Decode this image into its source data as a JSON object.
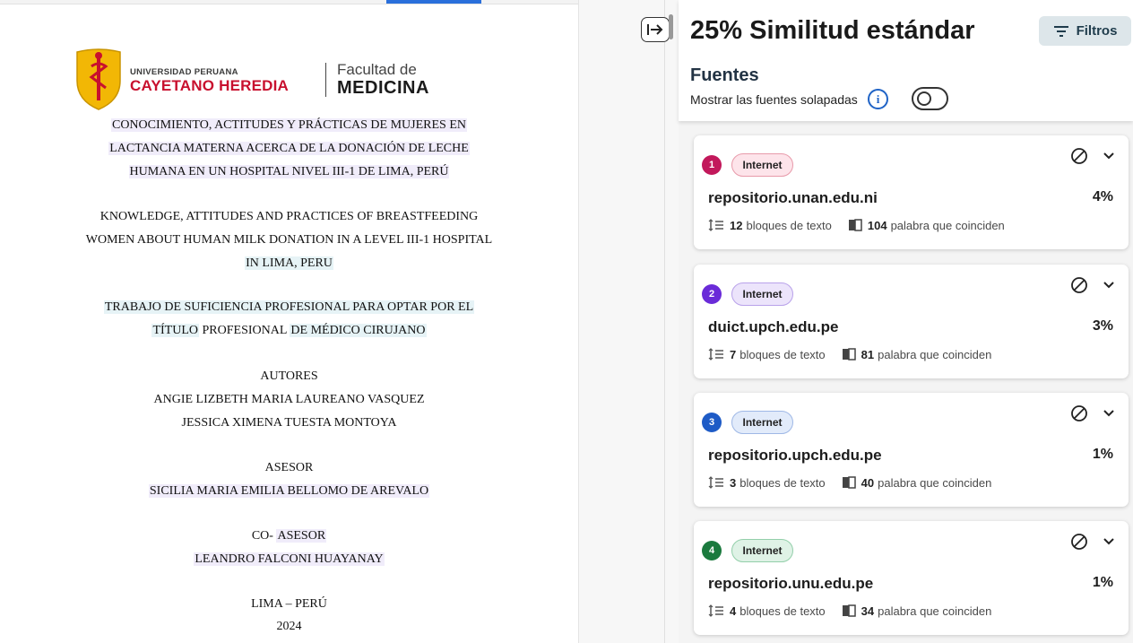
{
  "document": {
    "logo": {
      "university_line1": "UNIVERSIDAD PERUANA",
      "university_line2": "CAYETANO HEREDIA",
      "faculty_line1": "Facultad de",
      "faculty_line2": "MEDICINA",
      "shield_colors": [
        "#f2b705",
        "#c8102e"
      ]
    },
    "title_es": [
      "CONOCIMIENTO, ACTITUDES Y PRÁCTICAS DE MUJERES EN",
      "LACTANCIA MATERNA ACERCA DE LA DONACIÓN DE LECHE",
      "HUMANA EN UN HOSPITAL NIVEL III-1 DE LIMA, PERÚ"
    ],
    "title_en": [
      "KNOWLEDGE, ATTITUDES AND PRACTICES OF BREASTFEEDING",
      "WOMEN ABOUT HUMAN MILK DONATION IN A LEVEL III-1 HOSPITAL",
      "IN LIMA, PERU"
    ],
    "work_type": {
      "line1": "TRABAJO DE SUFICIENCIA PROFESIONAL PARA OPTAR POR EL",
      "line2_a": "TÍTULO",
      "line2_b": " PROFESIONAL ",
      "line2_c": "DE MÉDICO CIRUJANO"
    },
    "authors_label": "AUTORES",
    "authors": [
      "ANGIE LIZBETH MARIA LAUREANO VASQUEZ",
      "JESSICA XIMENA TUESTA MONTOYA"
    ],
    "advisor_label": "ASESOR",
    "advisor": "SICILIA MARIA EMILIA BELLOMO DE AREVALO",
    "coadvisor_label_a": "CO- ",
    "coadvisor_label_b": "ASESOR",
    "coadvisor": "LEANDRO FALCONI HUAYANAY",
    "place": "LIMA – PERÚ",
    "year": "2024"
  },
  "panel": {
    "similarity_title": "25% Similitud estándar",
    "filter_label": "Filtros",
    "sources_heading": "Fuentes",
    "overlap_label": "Mostrar las fuentes solapadas",
    "overlap_enabled": false
  },
  "sources": [
    {
      "number": "1",
      "type": "Internet",
      "domain": "repositorio.unan.edu.ni",
      "percent": "4%",
      "blocks": "12",
      "blocks_label": "bloques de texto",
      "words": "104",
      "words_label": "palabra que coinciden",
      "color": "#c2185b",
      "badge_bg": "#fde4ea",
      "badge_border": "#e89aaa"
    },
    {
      "number": "2",
      "type": "Internet",
      "domain": "duict.upch.edu.pe",
      "percent": "3%",
      "blocks": "7",
      "blocks_label": "bloques de texto",
      "words": "81",
      "words_label": "palabra que coinciden",
      "color": "#6a2bd8",
      "badge_bg": "#ece4fb",
      "badge_border": "#b9a2ea"
    },
    {
      "number": "3",
      "type": "Internet",
      "domain": "repositorio.upch.edu.pe",
      "percent": "1%",
      "blocks": "3",
      "blocks_label": "bloques de texto",
      "words": "40",
      "words_label": "palabra que coinciden",
      "color": "#1e5bc6",
      "badge_bg": "#e2ebfa",
      "badge_border": "#9fb8e6"
    },
    {
      "number": "4",
      "type": "Internet",
      "domain": "repositorio.unu.edu.pe",
      "percent": "1%",
      "blocks": "4",
      "blocks_label": "bloques de texto",
      "words": "34",
      "words_label": "palabra que coinciden",
      "color": "#1b7a3e",
      "badge_bg": "#dff2e6",
      "badge_border": "#93cfaa"
    }
  ]
}
